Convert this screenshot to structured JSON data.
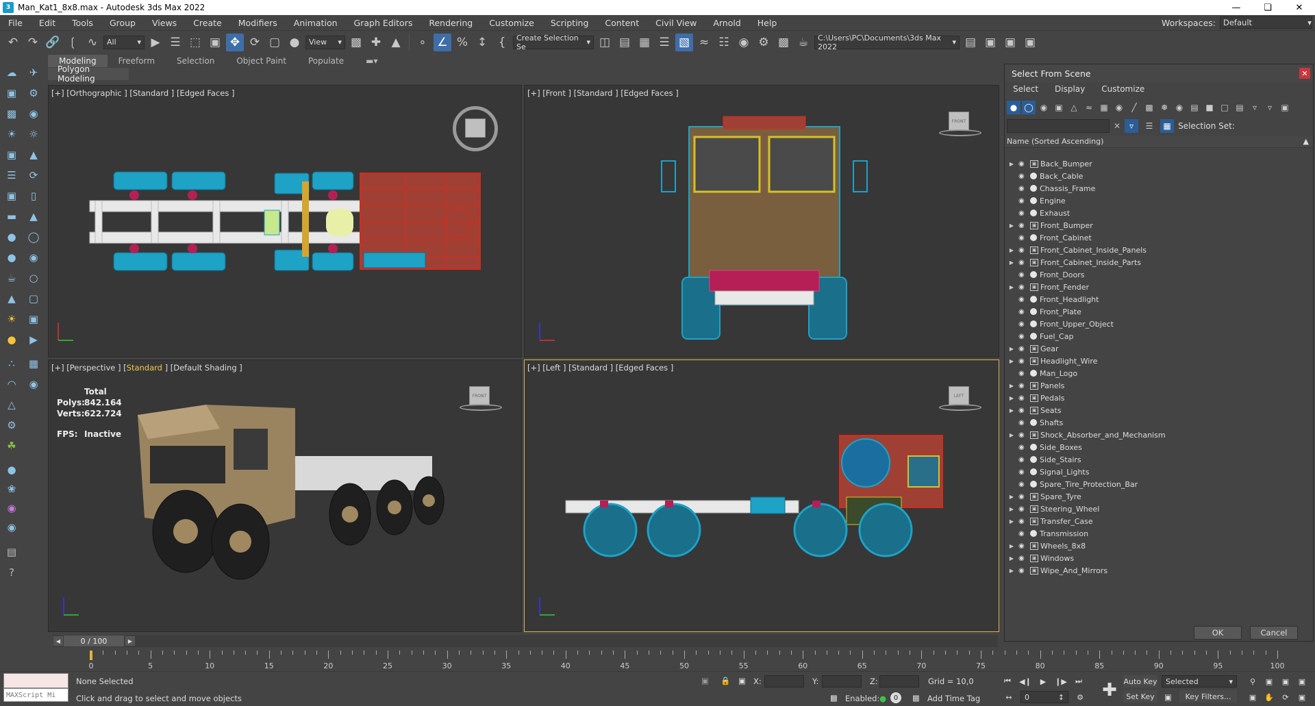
{
  "window": {
    "title": "Man_Kat1_8x8.max - Autodesk 3ds Max 2022",
    "app_icon_text": "3"
  },
  "menu": [
    "File",
    "Edit",
    "Tools",
    "Group",
    "Views",
    "Create",
    "Modifiers",
    "Animation",
    "Graph Editors",
    "Rendering",
    "Customize",
    "Scripting",
    "Content",
    "Civil View",
    "Arnold",
    "Help"
  ],
  "workspace": {
    "label": "Workspaces:",
    "value": "Default"
  },
  "toolbar": {
    "filter_value": "All",
    "view_value": "View",
    "selection_set": "Create Selection Se",
    "project_path": "C:\\Users\\PC\\Documents\\3ds Max 2022"
  },
  "ribbon": {
    "tabs": [
      "Modeling",
      "Freeform",
      "Selection",
      "Object Paint",
      "Populate"
    ],
    "active_tab": "Modeling",
    "sub_label": "Polygon Modeling"
  },
  "viewports": {
    "top_left": {
      "label_pre": "[+] [Orthographic ] [Standard ] [Edged Faces ]"
    },
    "top_right": {
      "label_pre": "[+] [Front ] [Standard ] [Edged Faces ]",
      "cube": "FRONT"
    },
    "bottom_left": {
      "label_a": "[+] [Perspective ] [",
      "label_hl": "Standard",
      "label_b": " ] [Default Shading ]",
      "cube": "FRONT"
    },
    "bottom_right": {
      "label_pre": "[+] [Left ] [Standard ] [Edged Faces ]",
      "cube": "LEFT"
    }
  },
  "stats": {
    "header": "Total",
    "polys_label": "Polys:",
    "polys": "842.164",
    "verts_label": "Verts:",
    "verts": "622.724",
    "fps_label": "FPS:",
    "fps": "Inactive"
  },
  "scene_panel": {
    "title": "Select From Scene",
    "menu": [
      "Select",
      "Display",
      "Customize"
    ],
    "selection_set_label": "Selection Set:",
    "column_header": "Name (Sorted Ascending)",
    "items": [
      {
        "name": "Back_Bumper",
        "group": true
      },
      {
        "name": "Back_Cable",
        "group": false
      },
      {
        "name": "Chassis_Frame",
        "group": false
      },
      {
        "name": "Engine",
        "group": false
      },
      {
        "name": "Exhaust",
        "group": false
      },
      {
        "name": "Front_Bumper",
        "group": true
      },
      {
        "name": "Front_Cabinet",
        "group": false
      },
      {
        "name": "Front_Cabinet_Inside_Panels",
        "group": true
      },
      {
        "name": "Front_Cabinet_Inside_Parts",
        "group": true
      },
      {
        "name": "Front_Doors",
        "group": false
      },
      {
        "name": "Front_Fender",
        "group": true
      },
      {
        "name": "Front_Headlight",
        "group": false
      },
      {
        "name": "Front_Plate",
        "group": false
      },
      {
        "name": "Front_Upper_Object",
        "group": false
      },
      {
        "name": "Fuel_Cap",
        "group": false
      },
      {
        "name": "Gear",
        "group": true
      },
      {
        "name": "Headlight_Wire",
        "group": true
      },
      {
        "name": "Man_Logo",
        "group": false
      },
      {
        "name": "Panels",
        "group": true
      },
      {
        "name": "Pedals",
        "group": true
      },
      {
        "name": "Seats",
        "group": true
      },
      {
        "name": "Shafts",
        "group": false
      },
      {
        "name": "Shock_Absorber_and_Mechanism",
        "group": true
      },
      {
        "name": "Side_Boxes",
        "group": false
      },
      {
        "name": "Side_Stairs",
        "group": false
      },
      {
        "name": "Signal_Lights",
        "group": false
      },
      {
        "name": "Spare_Tire_Protection_Bar",
        "group": false
      },
      {
        "name": "Spare_Tyre",
        "group": true
      },
      {
        "name": "Steering_Wheel",
        "group": true
      },
      {
        "name": "Transfer_Case",
        "group": true
      },
      {
        "name": "Transmission",
        "group": false
      },
      {
        "name": "Wheels_8x8",
        "group": true
      },
      {
        "name": "Windows",
        "group": true
      },
      {
        "name": "Wipe_And_Mirrors",
        "group": true
      }
    ],
    "ok_label": "OK",
    "cancel_label": "Cancel"
  },
  "timeline": {
    "frame_display": "0 / 100",
    "ticks": [
      "0",
      "5",
      "10",
      "15",
      "20",
      "25",
      "30",
      "35",
      "40",
      "45",
      "50",
      "55",
      "60",
      "65",
      "70",
      "75",
      "80",
      "85",
      "90",
      "95",
      "100"
    ]
  },
  "status": {
    "maxscript_placeholder": "MAXScript Mi",
    "selection": "None Selected",
    "prompt": "Click and drag to select and move objects",
    "x_label": "X:",
    "y_label": "Y:",
    "z_label": "Z:",
    "grid": "Grid = 10,0",
    "enabled_label": "Enabled:",
    "enabled_value": "0",
    "add_time_tag": "Add Time Tag",
    "auto_key": "Auto Key",
    "set_key": "Set Key",
    "key_mode": "Selected",
    "key_filters": "Key Filters...",
    "current_frame": "0"
  },
  "colors": {
    "accent_blue": "#3e6ea8",
    "active_viewport_border": "#d9b24a",
    "close_red": "#c8363c"
  }
}
